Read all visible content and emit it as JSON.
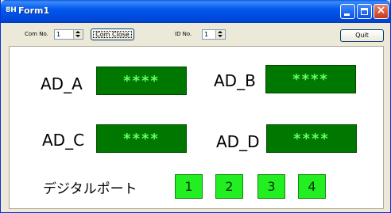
{
  "window": {
    "title": "Form1",
    "app_icon": "8H"
  },
  "toolbar": {
    "com_label": "Com No.",
    "com_value": "1",
    "com_close_label": "Com Close",
    "id_label": "ID No.",
    "id_value": "1",
    "quit_label": "Quit"
  },
  "ad": {
    "a": {
      "label": "AD_A",
      "value": "****"
    },
    "b": {
      "label": "AD_B",
      "value": "****"
    },
    "c": {
      "label": "AD_C",
      "value": "****"
    },
    "d": {
      "label": "AD_D",
      "value": "****"
    }
  },
  "digital": {
    "label": "デジタルポート",
    "ports": [
      "1",
      "2",
      "3",
      "4"
    ]
  },
  "colors": {
    "ad_box_bg": "#007800",
    "ad_box_text": "#66ff66",
    "port_bg": "#22ee22",
    "titlebar": "#0058EE"
  },
  "icons": [
    "minimize-icon",
    "maximize-icon",
    "close-icon",
    "spin-up-icon",
    "spin-down-icon"
  ]
}
